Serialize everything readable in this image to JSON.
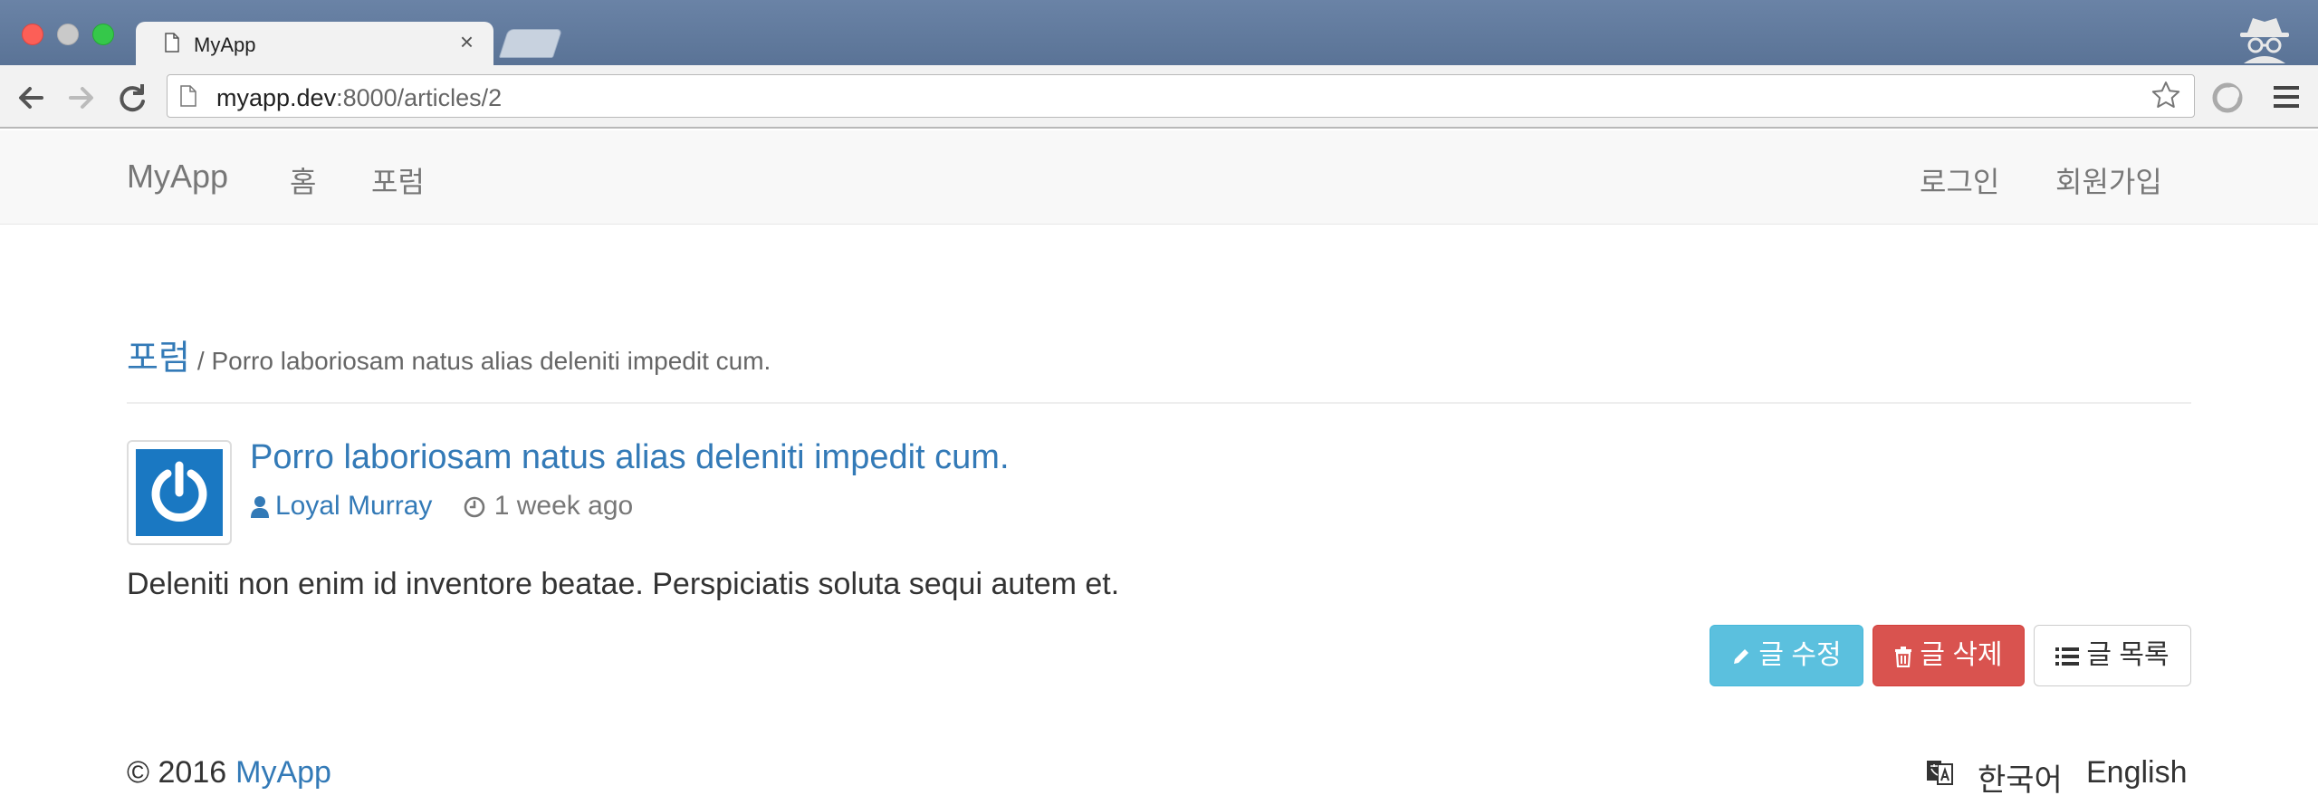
{
  "browser": {
    "tab_title": "MyApp",
    "tab_close": "×",
    "url_host": "myapp.dev",
    "url_rest": ":8000/articles/2"
  },
  "navbar": {
    "brand": "MyApp",
    "links": [
      "홈",
      "포럼"
    ],
    "right_links": [
      "로그인",
      "회원가입"
    ]
  },
  "breadcrumb": {
    "section": "포럼",
    "current": "/ Porro laboriosam natus alias deleniti impedit cum."
  },
  "article": {
    "title": "Porro laboriosam natus alias deleniti impedit cum.",
    "author": "Loyal Murray",
    "time_ago": "1 week ago",
    "body": "Deleniti non enim id inventore beatae. Perspiciatis soluta sequi autem et.",
    "avatar_color": "#1a78c2"
  },
  "actions": {
    "edit": "글 수정",
    "delete": "글 삭제",
    "list": "글 목록"
  },
  "footer": {
    "copyright": "© 2016",
    "brand_link": "MyApp",
    "lang_korean": "한국어",
    "lang_english": "English"
  },
  "colors": {
    "link": "#337ab7",
    "info": "#5bc0de",
    "danger": "#d9534f"
  }
}
